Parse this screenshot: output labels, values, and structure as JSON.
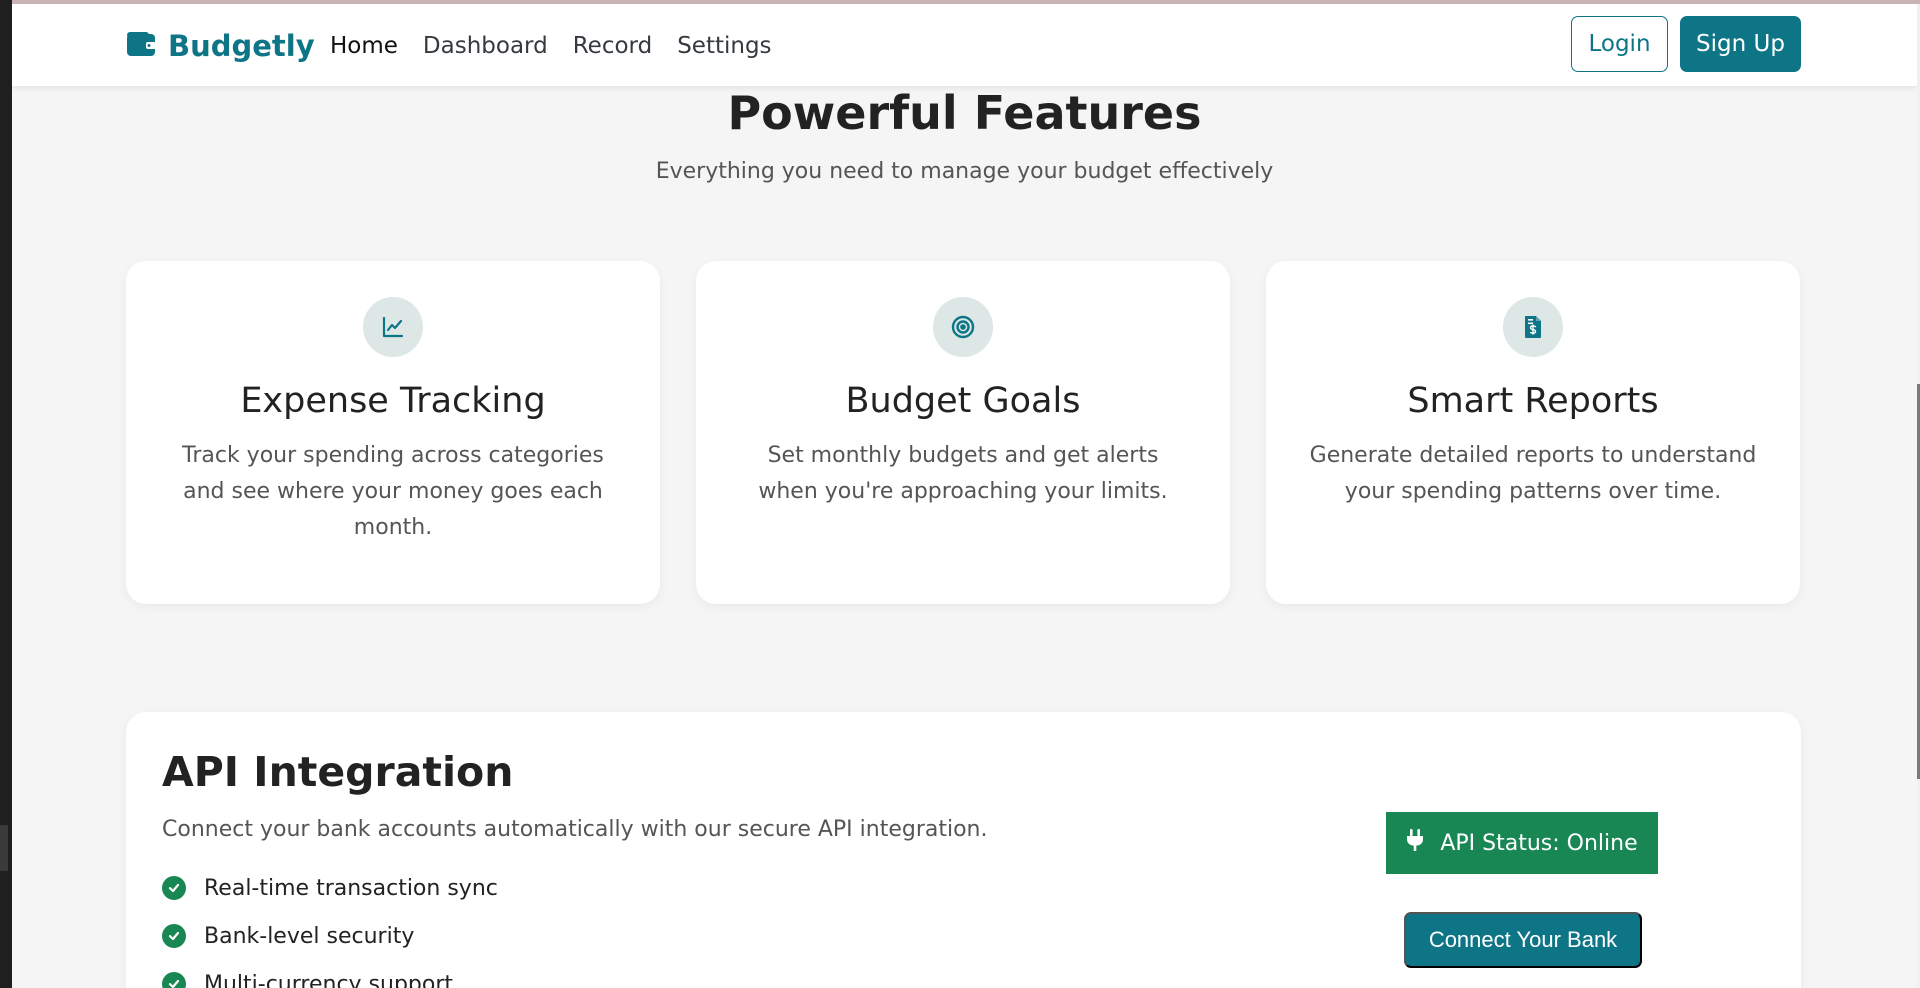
{
  "nav": {
    "brand": "Budgetly",
    "links": [
      "Home",
      "Dashboard",
      "Record",
      "Settings"
    ],
    "active_link": "Home",
    "login_label": "Login",
    "signup_label": "Sign Up"
  },
  "features": {
    "title": "Powerful Features",
    "subtitle": "Everything you need to manage your budget effectively",
    "cards": [
      {
        "icon": "chart-line-icon",
        "title": "Expense Tracking",
        "description": "Track your spending across categories and see where your money goes each month."
      },
      {
        "icon": "target-icon",
        "title": "Budget Goals",
        "description": "Set monthly budgets and get alerts when you're approaching your limits."
      },
      {
        "icon": "invoice-dollar-icon",
        "title": "Smart Reports",
        "description": "Generate detailed reports to understand your spending patterns over time."
      }
    ]
  },
  "api": {
    "title": "API Integration",
    "description": "Connect your bank accounts automatically with our secure API integration.",
    "features": [
      "Real-time transaction sync",
      "Bank-level security",
      "Multi-currency support"
    ],
    "status_label": "API Status: Online",
    "connect_label": "Connect Your Bank"
  },
  "colors": {
    "brand": "#0e7587",
    "success": "#198754",
    "background": "#f5f5f5",
    "icon_circle": "#dde7e5"
  }
}
